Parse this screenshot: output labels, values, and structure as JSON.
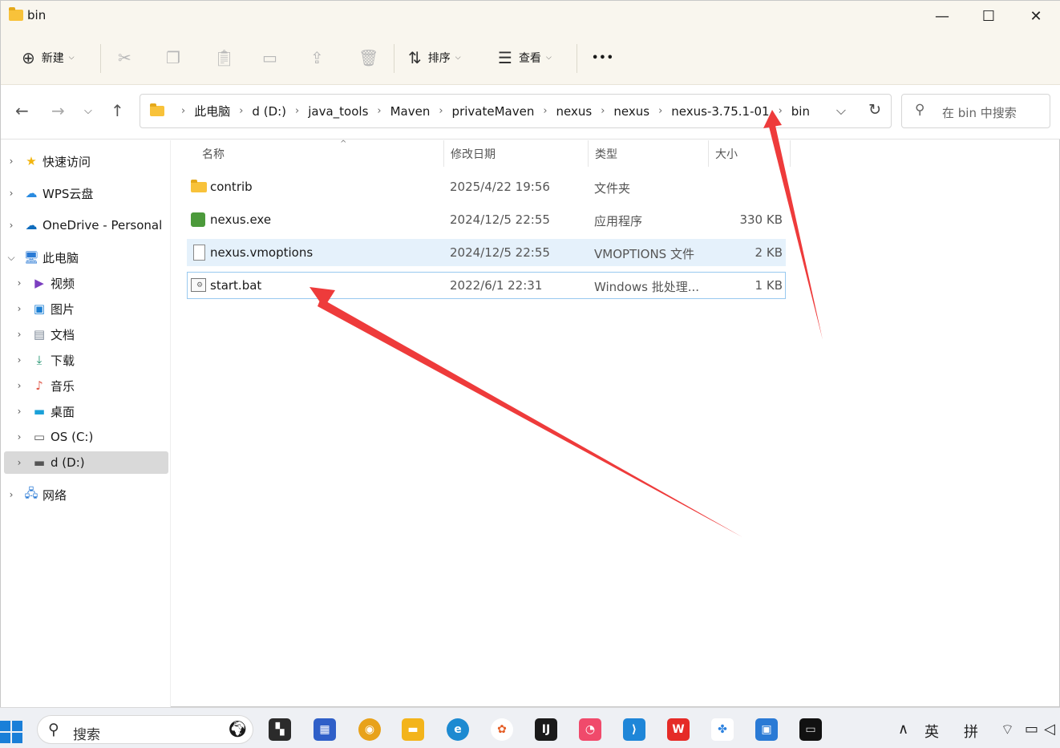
{
  "window": {
    "title": "bin",
    "controls": {
      "minimize": "—",
      "maximize": "☐",
      "close": "✕"
    }
  },
  "toolbar": {
    "new_label": "新建",
    "sort_label": "排序",
    "view_label": "查看",
    "more_label": "•••"
  },
  "address": {
    "crumbs": [
      "此电脑",
      "d (D:)",
      "java_tools",
      "Maven",
      "privateMaven",
      "nexus",
      "nexus",
      "nexus-3.75.1-01",
      "bin"
    ]
  },
  "search": {
    "placeholder": "在 bin 中搜索"
  },
  "sidebar": {
    "items": [
      {
        "label": "快速访问",
        "icon": "star-icon"
      },
      {
        "label": "WPS云盘",
        "icon": "cloud-icon"
      },
      {
        "label": "OneDrive - Personal",
        "icon": "onedrive-icon"
      },
      {
        "label": "此电脑",
        "icon": "pc-icon"
      },
      {
        "label": "视频",
        "icon": "video-icon"
      },
      {
        "label": "图片",
        "icon": "pictures-icon"
      },
      {
        "label": "文档",
        "icon": "documents-icon"
      },
      {
        "label": "下载",
        "icon": "download-icon"
      },
      {
        "label": "音乐",
        "icon": "music-icon"
      },
      {
        "label": "桌面",
        "icon": "desktop-icon"
      },
      {
        "label": "OS (C:)",
        "icon": "drive-icon"
      },
      {
        "label": "d (D:)",
        "icon": "drive-icon"
      },
      {
        "label": "网络",
        "icon": "network-icon"
      }
    ]
  },
  "columns": {
    "name": "名称",
    "modified": "修改日期",
    "type": "类型",
    "size": "大小"
  },
  "files": [
    {
      "name": "contrib",
      "modified": "2025/4/22 19:56",
      "type": "文件夹",
      "size": ""
    },
    {
      "name": "nexus.exe",
      "modified": "2024/12/5 22:55",
      "type": "应用程序",
      "size": "330 KB"
    },
    {
      "name": "nexus.vmoptions",
      "modified": "2024/12/5 22:55",
      "type": "VMOPTIONS 文件",
      "size": "2 KB"
    },
    {
      "name": "start.bat",
      "modified": "2022/6/1 22:31",
      "type": "Windows 批处理...",
      "size": "1 KB"
    }
  ],
  "taskbar": {
    "search_placeholder": "搜索",
    "ime_lang": "英",
    "ime_mode": "拼"
  },
  "colors": {
    "accent": "#0067c0",
    "folder": "#f8c23a",
    "selection": "#e5f1fb",
    "annotation_arrow": "#ee3b3b"
  }
}
